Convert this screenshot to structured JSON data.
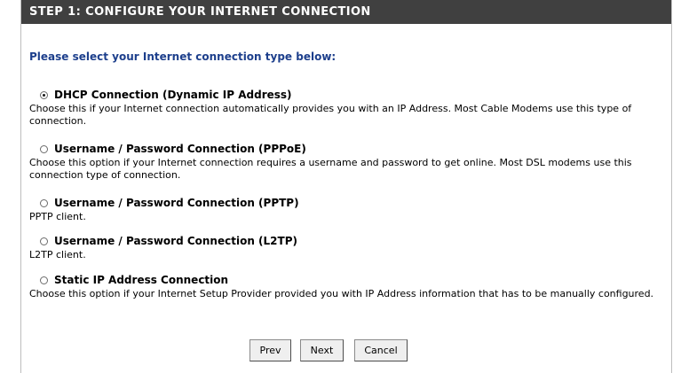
{
  "header": {
    "title": "STEP 1: CONFIGURE YOUR INTERNET CONNECTION"
  },
  "prompt": "Please select your Internet connection type below:",
  "options": [
    {
      "title": "DHCP Connection (Dynamic IP Address)",
      "desc": "Choose this if your Internet connection automatically provides you with an IP Address. Most Cable Modems use this type of connection.",
      "selected": true
    },
    {
      "title": "Username / Password Connection (PPPoE)",
      "desc": "Choose this option if your Internet connection requires a username and password to get online. Most DSL modems use this connection type of connection.",
      "selected": false
    },
    {
      "title": "Username / Password Connection (PPTP)",
      "desc": "PPTP client.",
      "selected": false
    },
    {
      "title": "Username / Password Connection (L2TP)",
      "desc": "L2TP client.",
      "selected": false
    },
    {
      "title": "Static IP Address Connection",
      "desc": "Choose this option if your Internet Setup Provider provided you with IP Address information that has to be manually configured.",
      "selected": false
    }
  ],
  "buttons": {
    "prev": "Prev",
    "next": "Next",
    "cancel": "Cancel"
  }
}
